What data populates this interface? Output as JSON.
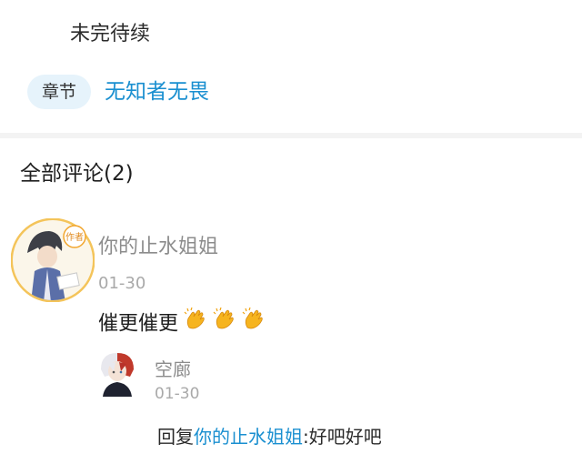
{
  "chapter": {
    "note": "未完待续",
    "pill_label": "章节",
    "link": "无知者无畏"
  },
  "comments": {
    "header": "全部评论(2)",
    "main": {
      "author": "你的止水姐姐",
      "date": "01-30",
      "text": "催更催更",
      "emoji": [
        "clap-emoji",
        "clap-emoji",
        "clap-emoji"
      ],
      "avatar_badge": "作者"
    },
    "reply": {
      "author": "空廊",
      "date": "01-30",
      "prefix": "回复",
      "mention": "你的止水姐姐",
      "separator": ":",
      "text": "好吧好吧"
    }
  },
  "colors": {
    "link": "#1a8fd0",
    "pill_bg": "#e6f3fb",
    "muted": "#8c8c8c",
    "divider": "#f3f3f3"
  }
}
